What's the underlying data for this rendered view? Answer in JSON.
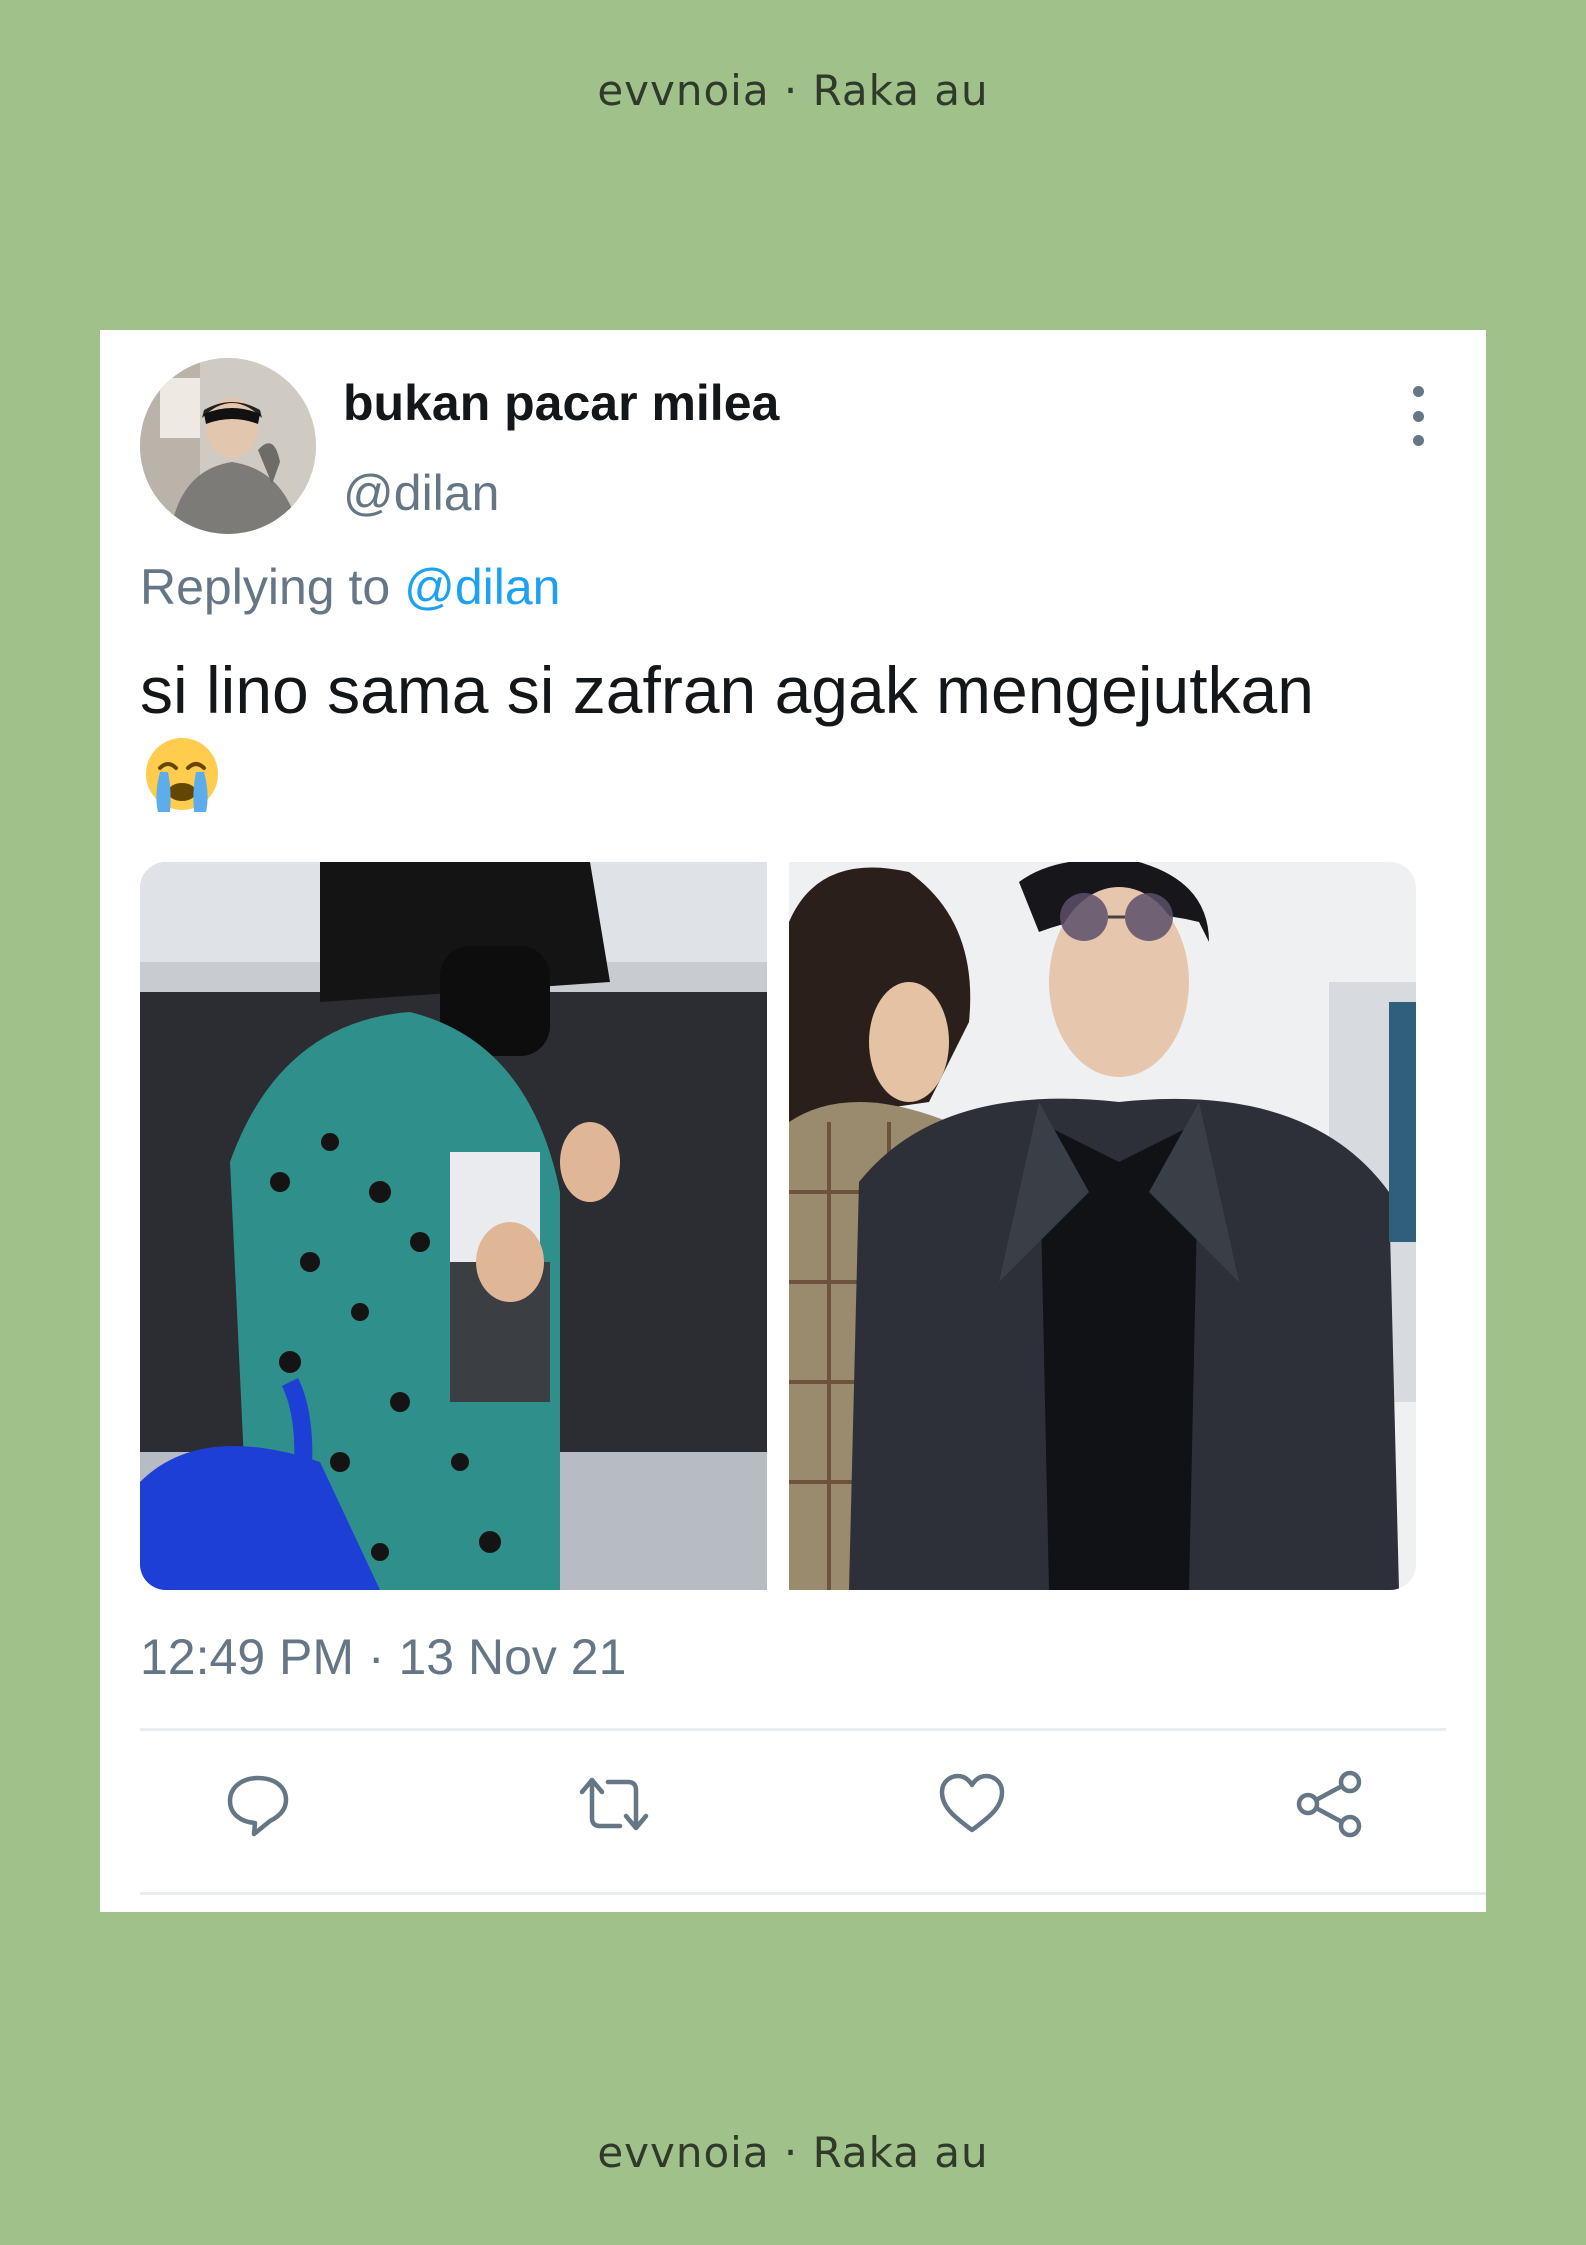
{
  "watermark": {
    "top": "evvnoia · Raka au",
    "bottom": "evvnoia · Raka au"
  },
  "tweet": {
    "display_name": "bukan pacar milea",
    "handle": "@dilan",
    "replying_prefix": "Replying to",
    "replying_to": "@dilan",
    "text": "si lino sama si zafran agak mengejutkan",
    "emoji": "loudly-crying-face",
    "timestamp": "12:49 PM · 13 Nov 21"
  },
  "actions": [
    "reply-icon",
    "retweet-icon",
    "like-icon",
    "share-icon"
  ],
  "colors": {
    "background": "#a0c18a",
    "card": "#ffffff",
    "text": "#14171a",
    "secondary": "#657786",
    "link": "#1da1f2"
  }
}
